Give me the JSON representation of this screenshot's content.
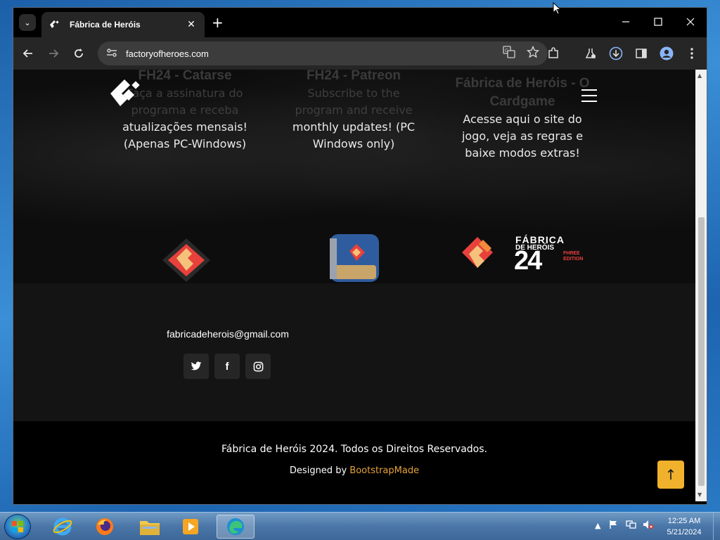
{
  "browser": {
    "tab_title": "Fábrica de Heróis",
    "tab_close": "✕",
    "new_tab": "+",
    "url": "factoryofheroes.com"
  },
  "page": {
    "columns": [
      {
        "heading": "FH24 - Catarse",
        "text_faded": "Faça a assinatura do programa e receba",
        "text": "atualizações mensais! (Apenas PC-Windows)"
      },
      {
        "heading": "FH24 - Patreon",
        "text_faded": "Subscribe to the program and receive",
        "text": "monthly updates! (PC Windows only)"
      },
      {
        "heading": "Fábrica de Heróis - O Cardgame",
        "text_faded": "",
        "text": "Acesse aqui o site do jogo, veja as regras e baixe modos extras!"
      }
    ],
    "logo3": {
      "line1": "FÁBRICA",
      "line2": "DE HERÓIS",
      "number": "24",
      "edition": "FHREE EDITION"
    },
    "footer": {
      "email": "fabricadeherois@gmail.com",
      "social": [
        {
          "icon": "twitter-icon",
          "glyph": "🐦"
        },
        {
          "icon": "facebook-icon",
          "glyph": "f"
        },
        {
          "icon": "instagram-icon",
          "glyph": "◎"
        }
      ]
    },
    "copyright": "Fábrica de Heróis 2024. Todos os Direitos Reservados.",
    "designed_by_prefix": "Designed by",
    "designed_by_link": "BootstrapMade",
    "back_to_top": "↑"
  },
  "taskbar": {
    "time": "12:25 AM",
    "date": "5/21/2024"
  },
  "colors": {
    "accent": "#f0b22c",
    "link": "#e6a33a",
    "footer_bg": "#141414"
  }
}
